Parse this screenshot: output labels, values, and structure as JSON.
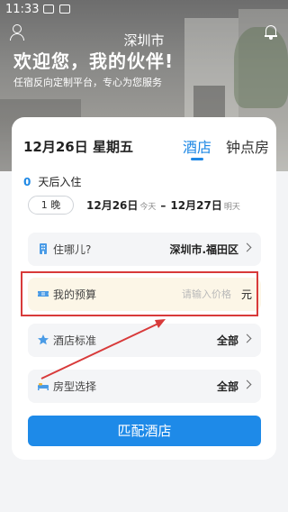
{
  "status_bar": {
    "time": "11:33"
  },
  "hero": {
    "city": "深圳市",
    "slogan": "欢迎您，我的伙伴!",
    "subslogan": "任宿反向定制平台，专心为您服务"
  },
  "booking": {
    "date_main": "12月26日  星期五",
    "tabs": [
      {
        "label": "酒店",
        "active": true
      },
      {
        "label": "钟点房",
        "active": false
      }
    ],
    "days_after_num": "0",
    "days_after_label": "天后入住",
    "nights": "1 晚",
    "checkin_date": "12月26日",
    "checkin_tag": "今天",
    "dash": "–",
    "checkout_date": "12月27日",
    "checkout_tag": "明天"
  },
  "form": {
    "location": {
      "label": "住哪儿?",
      "value": "深圳市.福田区",
      "icon": "building-icon"
    },
    "budget": {
      "label": "我的预算",
      "placeholder": "请输入价格",
      "unit": "元",
      "icon": "ticket-icon"
    },
    "standard": {
      "label": "酒店标准",
      "value": "全部",
      "icon": "star-icon"
    },
    "room_type": {
      "label": "房型选择",
      "value": "全部",
      "icon": "bed-icon"
    }
  },
  "actions": {
    "match_label": "匹配酒店"
  },
  "colors": {
    "accent": "#1e88e5",
    "annotation": "#d83a3a",
    "budget_bg": "#fcf6e7"
  }
}
